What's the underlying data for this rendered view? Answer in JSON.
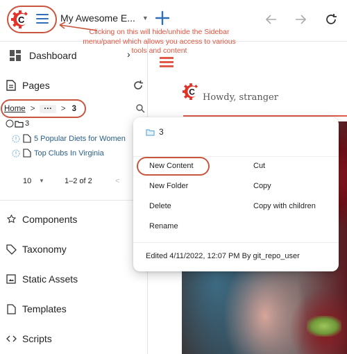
{
  "topbar": {
    "site_name": "My Awesome E...",
    "add_label": "+",
    "annotation": "Clicking on this will hide/unhide the Sidebar menu/panel which allows you access to various tools and content"
  },
  "sidebar": {
    "dashboard_label": "Dashboard",
    "pages_label": "Pages",
    "breadcrumb": {
      "home": "Home",
      "ellipsis": "···",
      "current": "3",
      "separator": ">"
    },
    "tree": {
      "root_label": "3",
      "items": [
        {
          "label": "5 Popular Diets for Women"
        },
        {
          "label": "Top Clubs In Virginia"
        }
      ]
    },
    "pager": {
      "page_size": "10",
      "range": "1–2 of 2",
      "prev": "<"
    },
    "items": [
      {
        "label": "Components"
      },
      {
        "label": "Taxonomy"
      },
      {
        "label": "Static Assets"
      },
      {
        "label": "Templates"
      },
      {
        "label": "Scripts"
      }
    ]
  },
  "preview": {
    "greeting": "Howdy, stranger"
  },
  "context_menu": {
    "title": "3",
    "left_items": [
      "New Content",
      "New Folder",
      "Delete",
      "Rename"
    ],
    "right_items": [
      "Cut",
      "Copy",
      "Copy with children"
    ],
    "footer": "Edited 4/11/2022, 12:07 PM By git_repo_user"
  },
  "colors": {
    "brand_red": "#e0332a",
    "accent_blue": "#2f6fb8",
    "annotation_red": "#c8553d",
    "link_blue": "#2a5f8a"
  }
}
